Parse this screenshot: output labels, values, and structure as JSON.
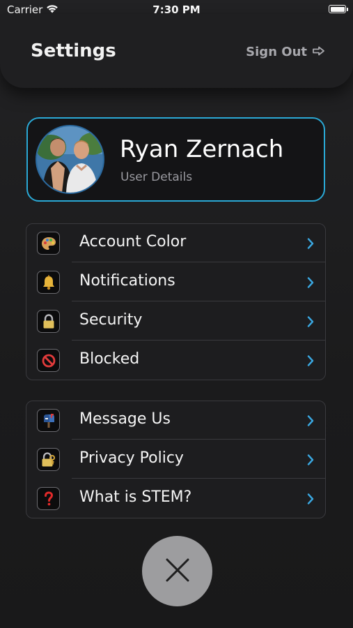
{
  "status_bar": {
    "carrier": "Carrier",
    "time": "7:30 PM"
  },
  "header": {
    "title": "Settings",
    "sign_out_label": "Sign Out"
  },
  "profile": {
    "name": "Ryan Zernach",
    "subtitle": "User Details",
    "accent_color": "#2aa9d6"
  },
  "groups": [
    {
      "items": [
        {
          "label": "Account Color",
          "icon": "palette-icon"
        },
        {
          "label": "Notifications",
          "icon": "bell-icon"
        },
        {
          "label": "Security",
          "icon": "lock-icon"
        },
        {
          "label": "Blocked",
          "icon": "prohibited-icon"
        }
      ]
    },
    {
      "items": [
        {
          "label": "Message Us",
          "icon": "mailbox-icon"
        },
        {
          "label": "Privacy Policy",
          "icon": "lock-with-key-icon"
        },
        {
          "label": "What is STEM?",
          "icon": "question-mark-icon"
        }
      ]
    }
  ],
  "colors": {
    "chevron": "#3aa7e0",
    "close_button": "#9d9d9f"
  }
}
